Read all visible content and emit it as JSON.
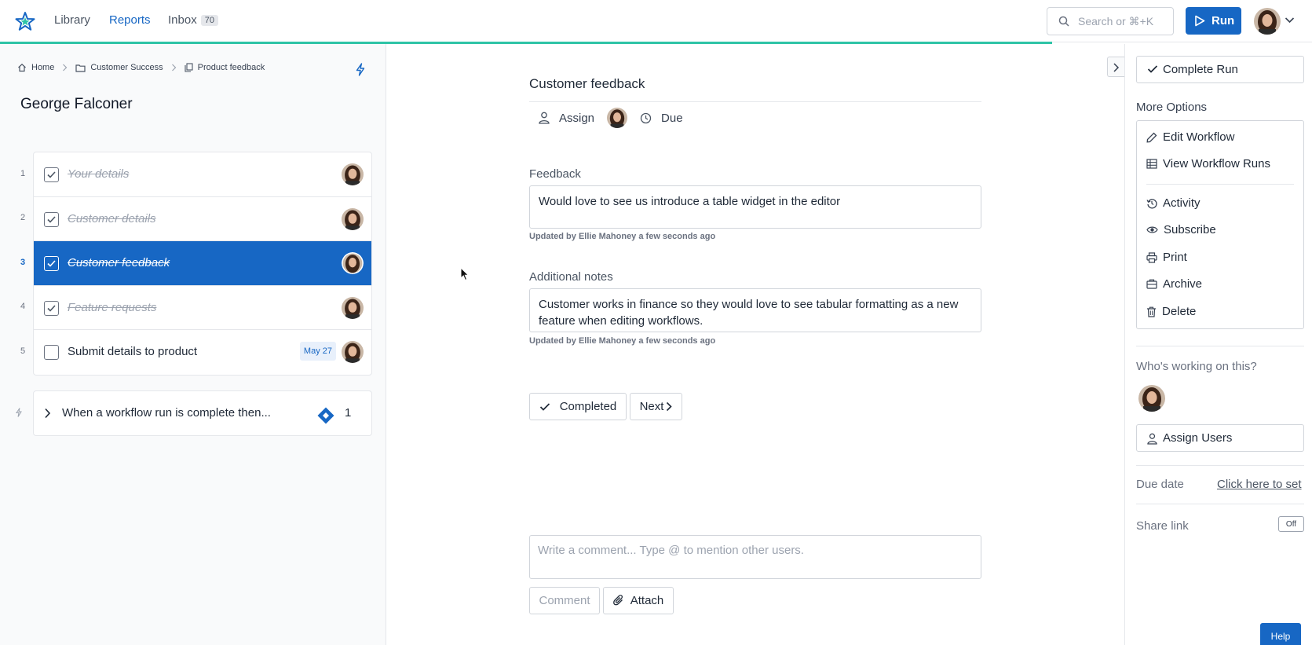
{
  "nav": {
    "library": "Library",
    "reports": "Reports",
    "inbox": "Inbox",
    "inbox_count": "70",
    "search_placeholder": "Search or ⌘+K",
    "run_label": "Run"
  },
  "breadcrumb": {
    "home": "Home",
    "folder": "Customer Success",
    "workflow": "Product feedback"
  },
  "assignee": "George Falconer",
  "tasks": [
    {
      "num": "1",
      "label": "Your details"
    },
    {
      "num": "2",
      "label": "Customer details"
    },
    {
      "num": "3",
      "label": "Customer feedback"
    },
    {
      "num": "4",
      "label": "Feature requests"
    },
    {
      "num": "5",
      "label": "Submit details to product",
      "due": "May 27"
    }
  ],
  "automation": {
    "label": "When a workflow run is complete then...",
    "count": "1"
  },
  "main": {
    "title": "Customer feedback",
    "assign_label": "Assign",
    "due_label": "Due",
    "feedback_label": "Feedback",
    "feedback_value": "Would love to see us introduce a table widget in the editor",
    "feedback_meta": "Updated by Ellie Mahoney a few seconds ago",
    "notes_label": "Additional notes",
    "notes_value": "Customer works in finance so they would love to see tabular formatting as a new feature when editing workflows.",
    "notes_meta": "Updated by Ellie Mahoney a few seconds ago",
    "completed_label": "Completed",
    "next_label": "Next",
    "comment_placeholder": "Write a comment... Type @ to mention other users.",
    "comment_btn": "Comment",
    "attach_btn": "Attach"
  },
  "sidebar": {
    "complete_run": "Complete Run",
    "more_options": "More Options",
    "options": [
      "Edit Workflow",
      "View Workflow Runs",
      "Activity",
      "Subscribe",
      "Print",
      "Archive",
      "Delete"
    ],
    "working_heading": "Who's working on this?",
    "assign_users": "Assign Users",
    "due_date_label": "Due date",
    "due_date_link": "Click here to set",
    "share_link_label": "Share link",
    "share_toggle": "Off"
  },
  "help": "Help",
  "colors": {
    "accent": "#1767c4",
    "progress": "#2ec4a6"
  }
}
